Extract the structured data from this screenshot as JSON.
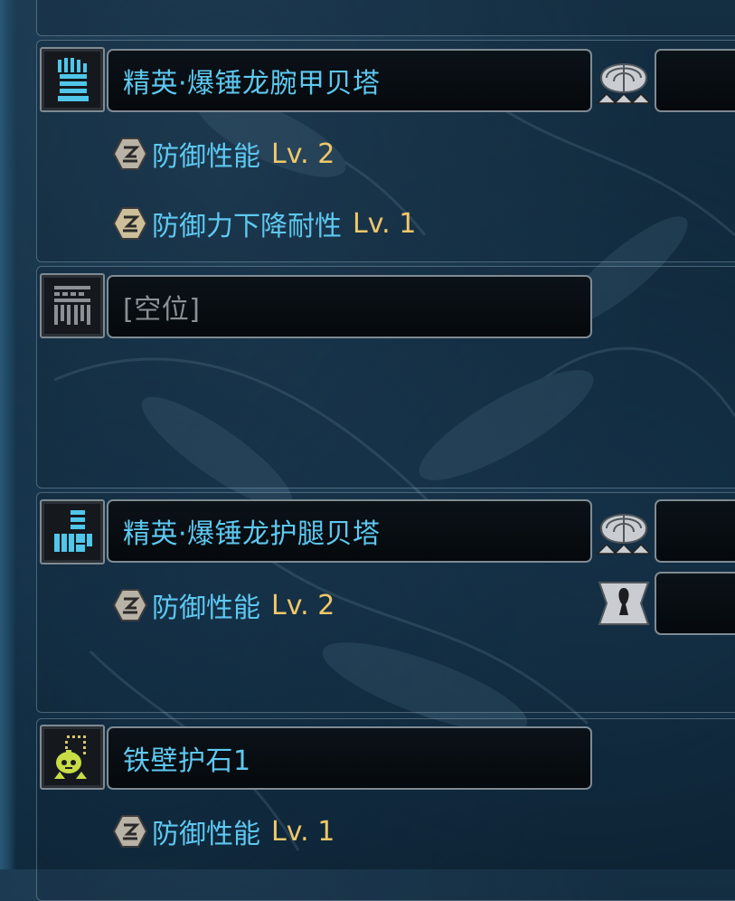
{
  "equipment": [
    {
      "slot_icon": "arm-armor-icon",
      "name": "精英·爆锤龙腕甲贝塔",
      "empty": false,
      "skills": [
        {
          "name": "防御性能",
          "level": "Lv. 2"
        },
        {
          "name": "防御力下降耐性",
          "level": "Lv. 1"
        }
      ],
      "decoration_slots": [
        "large-decoration-slot-icon"
      ]
    },
    {
      "slot_icon": "waist-armor-icon",
      "name": "[空位]",
      "empty": true,
      "skills": [],
      "decoration_slots": []
    },
    {
      "slot_icon": "leg-armor-icon",
      "name": "精英·爆锤龙护腿贝塔",
      "empty": false,
      "skills": [
        {
          "name": "防御性能",
          "level": "Lv. 2"
        }
      ],
      "decoration_slots": [
        "large-decoration-slot-icon",
        "small-decoration-slot-icon"
      ]
    },
    {
      "slot_icon": "charm-icon",
      "name": "铁壁护石1",
      "empty": false,
      "skills": [
        {
          "name": "防御性能",
          "level": "Lv. 1"
        }
      ],
      "decoration_slots": []
    }
  ],
  "colors": {
    "item_name": "#5ec8f0",
    "skill_name": "#5ec8f0",
    "skill_level": "#f0c76a",
    "empty_text": "#8a9095"
  }
}
